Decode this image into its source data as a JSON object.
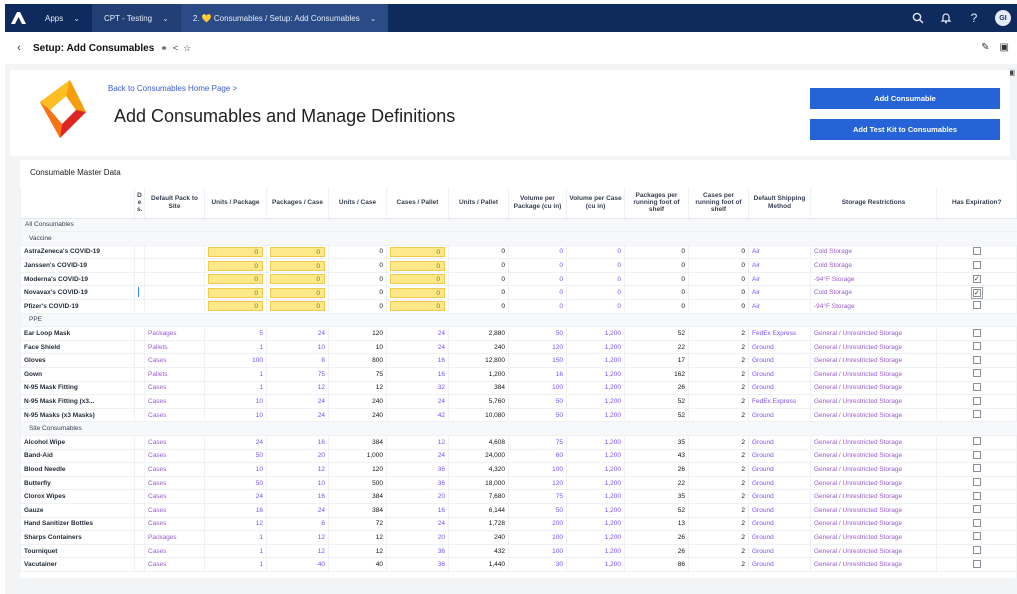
{
  "topbar": {
    "apps_label": "Apps",
    "workspace_label": "CPT - Testing",
    "tab_label": "2. 💛 Consumables / Setup: Add Consumables",
    "icons": [
      "search-icon",
      "bell-icon",
      "help-icon"
    ],
    "avatar_initials": "GI"
  },
  "subbar": {
    "title": "Setup: Add Consumables",
    "icons": [
      "sync-icon",
      "share-icon",
      "star-icon",
      "edit-icon",
      "comment-icon"
    ]
  },
  "header": {
    "back_link": "Back to Consumables Home Page >",
    "heading": "Add Consumables and Manage Definitions",
    "btn_add": "Add Consumable",
    "btn_kit": "Add Test Kit to Consumables"
  },
  "table": {
    "caption": "Consumable Master Data",
    "columns": [
      "",
      "D e s.",
      "Default Pack to Site",
      "Units / Package",
      "Packages / Case",
      "Units / Case",
      "Cases / Pallet",
      "Units / Pallet",
      "Volume per Package (cu in)",
      "Volume per Case (cu in)",
      "Packages per running foot of shelf",
      "Cases per running foot of shelf",
      "Default Shipping Method",
      "Storage Restrictions",
      "Has Expiration?"
    ],
    "all_label": "All Consumables",
    "groups": [
      {
        "name": "Vaccine",
        "rows": [
          {
            "name": "AstraZeneca's COVID-19",
            "pack": "",
            "upp": "0",
            "ppc": "0",
            "upc": "0",
            "cpp": "0",
            "upl": "0",
            "vpp": "0",
            "vpc": "0",
            "prf": "0",
            "crf": "0",
            "ship": "Air",
            "storage": "Cold Storage",
            "exp": false
          },
          {
            "name": "Janssen's COVID-19",
            "pack": "",
            "upp": "0",
            "ppc": "0",
            "upc": "0",
            "cpp": "0",
            "upl": "0",
            "vpp": "0",
            "vpc": "0",
            "prf": "0",
            "crf": "0",
            "ship": "Air",
            "storage": "Cold Storage",
            "exp": false
          },
          {
            "name": "Moderna's COVID-19",
            "pack": "",
            "upp": "0",
            "ppc": "0",
            "upc": "0",
            "cpp": "0",
            "upl": "0",
            "vpp": "0",
            "vpc": "0",
            "prf": "0",
            "crf": "0",
            "ship": "Air",
            "storage": "-94°F Storage",
            "exp": true
          },
          {
            "name": "Novavax's COVID-19",
            "pack": "",
            "upp": "0",
            "ppc": "0",
            "upc": "0",
            "cpp": "0",
            "upl": "0",
            "vpp": "0",
            "vpc": "0",
            "prf": "0",
            "crf": "0",
            "ship": "Air",
            "storage": "Cold Storage",
            "exp": true
          },
          {
            "name": "Pfizer's COVID-19",
            "pack": "",
            "upp": "0",
            "ppc": "0",
            "upc": "0",
            "cpp": "0",
            "upl": "0",
            "vpp": "0",
            "vpc": "0",
            "prf": "0",
            "crf": "0",
            "ship": "Air",
            "storage": "-94°F Storage",
            "exp": false
          }
        ]
      },
      {
        "name": "PPE",
        "rows": [
          {
            "name": "Ear Loop Mask",
            "pack": "Packages",
            "upp": "5",
            "ppc": "24",
            "upc": "120",
            "cpp": "24",
            "upl": "2,880",
            "vpp": "50",
            "vpc": "1,200",
            "prf": "52",
            "crf": "2",
            "ship": "FedEx Express",
            "storage": "General / Unrestricted Storage",
            "exp": false
          },
          {
            "name": "Face Shield",
            "pack": "Pallets",
            "upp": "1",
            "ppc": "10",
            "upc": "10",
            "cpp": "24",
            "upl": "240",
            "vpp": "120",
            "vpc": "1,200",
            "prf": "22",
            "crf": "2",
            "ship": "Ground",
            "storage": "General / Unrestricted Storage",
            "exp": false
          },
          {
            "name": "Gloves",
            "pack": "Cases",
            "upp": "100",
            "ppc": "8",
            "upc": "800",
            "cpp": "16",
            "upl": "12,800",
            "vpp": "150",
            "vpc": "1,200",
            "prf": "17",
            "crf": "2",
            "ship": "Ground",
            "storage": "General / Unrestricted Storage",
            "exp": false
          },
          {
            "name": "Gown",
            "pack": "Pallets",
            "upp": "1",
            "ppc": "75",
            "upc": "75",
            "cpp": "16",
            "upl": "1,200",
            "vpp": "16",
            "vpc": "1,200",
            "prf": "162",
            "crf": "2",
            "ship": "Ground",
            "storage": "General / Unrestricted Storage",
            "exp": false
          },
          {
            "name": "N-95 Mask Fitting",
            "pack": "Cases",
            "upp": "1",
            "ppc": "12",
            "upc": "12",
            "cpp": "32",
            "upl": "384",
            "vpp": "100",
            "vpc": "1,200",
            "prf": "26",
            "crf": "2",
            "ship": "Ground",
            "storage": "General / Unrestricted Storage",
            "exp": false
          },
          {
            "name": "N-95 Mask Fitting (x3...",
            "pack": "Cases",
            "upp": "10",
            "ppc": "24",
            "upc": "240",
            "cpp": "24",
            "upl": "5,760",
            "vpp": "50",
            "vpc": "1,200",
            "prf": "52",
            "crf": "2",
            "ship": "FedEx Express",
            "storage": "General / Unrestricted Storage",
            "exp": false
          },
          {
            "name": "N-95 Masks (x3 Masks)",
            "pack": "Cases",
            "upp": "10",
            "ppc": "24",
            "upc": "240",
            "cpp": "42",
            "upl": "10,080",
            "vpp": "50",
            "vpc": "1,200",
            "prf": "52",
            "crf": "2",
            "ship": "Ground",
            "storage": "General / Unrestricted Storage",
            "exp": false
          }
        ]
      },
      {
        "name": "Site Consumables",
        "rows": [
          {
            "name": "Alcohol Wipe",
            "pack": "Cases",
            "upp": "24",
            "ppc": "16",
            "upc": "384",
            "cpp": "12",
            "upl": "4,608",
            "vpp": "75",
            "vpc": "1,200",
            "prf": "35",
            "crf": "2",
            "ship": "Ground",
            "storage": "General / Unrestricted Storage",
            "exp": false
          },
          {
            "name": "Band-Aid",
            "pack": "Cases",
            "upp": "50",
            "ppc": "20",
            "upc": "1,000",
            "cpp": "24",
            "upl": "24,000",
            "vpp": "60",
            "vpc": "1,200",
            "prf": "43",
            "crf": "2",
            "ship": "Ground",
            "storage": "General / Unrestricted Storage",
            "exp": false
          },
          {
            "name": "Blood Needle",
            "pack": "Cases",
            "upp": "10",
            "ppc": "12",
            "upc": "120",
            "cpp": "36",
            "upl": "4,320",
            "vpp": "100",
            "vpc": "1,200",
            "prf": "26",
            "crf": "2",
            "ship": "Ground",
            "storage": "General / Unrestricted Storage",
            "exp": false
          },
          {
            "name": "Butterfly",
            "pack": "Cases",
            "upp": "50",
            "ppc": "10",
            "upc": "500",
            "cpp": "36",
            "upl": "18,000",
            "vpp": "120",
            "vpc": "1,200",
            "prf": "22",
            "crf": "2",
            "ship": "Ground",
            "storage": "General / Unrestricted Storage",
            "exp": false
          },
          {
            "name": "Clorox Wipes",
            "pack": "Cases",
            "upp": "24",
            "ppc": "16",
            "upc": "384",
            "cpp": "20",
            "upl": "7,680",
            "vpp": "75",
            "vpc": "1,200",
            "prf": "35",
            "crf": "2",
            "ship": "Ground",
            "storage": "General / Unrestricted Storage",
            "exp": false
          },
          {
            "name": "Gauze",
            "pack": "Cases",
            "upp": "16",
            "ppc": "24",
            "upc": "384",
            "cpp": "16",
            "upl": "6,144",
            "vpp": "50",
            "vpc": "1,200",
            "prf": "52",
            "crf": "2",
            "ship": "Ground",
            "storage": "General / Unrestricted Storage",
            "exp": false
          },
          {
            "name": "Hand Sanitizer Bottles",
            "pack": "Cases",
            "upp": "12",
            "ppc": "6",
            "upc": "72",
            "cpp": "24",
            "upl": "1,728",
            "vpp": "200",
            "vpc": "1,200",
            "prf": "13",
            "crf": "2",
            "ship": "Ground",
            "storage": "General / Unrestricted Storage",
            "exp": false
          },
          {
            "name": "Sharps Containers",
            "pack": "Packages",
            "upp": "1",
            "ppc": "12",
            "upc": "12",
            "cpp": "20",
            "upl": "240",
            "vpp": "100",
            "vpc": "1,200",
            "prf": "26",
            "crf": "2",
            "ship": "Ground",
            "storage": "General / Unrestricted Storage",
            "exp": false
          },
          {
            "name": "Tourniquet",
            "pack": "Cases",
            "upp": "1",
            "ppc": "12",
            "upc": "12",
            "cpp": "36",
            "upl": "432",
            "vpp": "100",
            "vpc": "1,200",
            "prf": "26",
            "crf": "2",
            "ship": "Ground",
            "storage": "General / Unrestricted Storage",
            "exp": false
          },
          {
            "name": "Vacutainer",
            "pack": "Cases",
            "upp": "1",
            "ppc": "40",
            "upc": "40",
            "cpp": "36",
            "upl": "1,440",
            "vpp": "30",
            "vpc": "1,200",
            "prf": "86",
            "crf": "2",
            "ship": "Ground",
            "storage": "General / Unrestricted Storage",
            "exp": false
          }
        ]
      }
    ]
  },
  "colors": {
    "topbar": "#0f2a5c",
    "primary_button": "#2563d6",
    "link": "#7c4dff",
    "yellow_cell": "#fde98a"
  }
}
